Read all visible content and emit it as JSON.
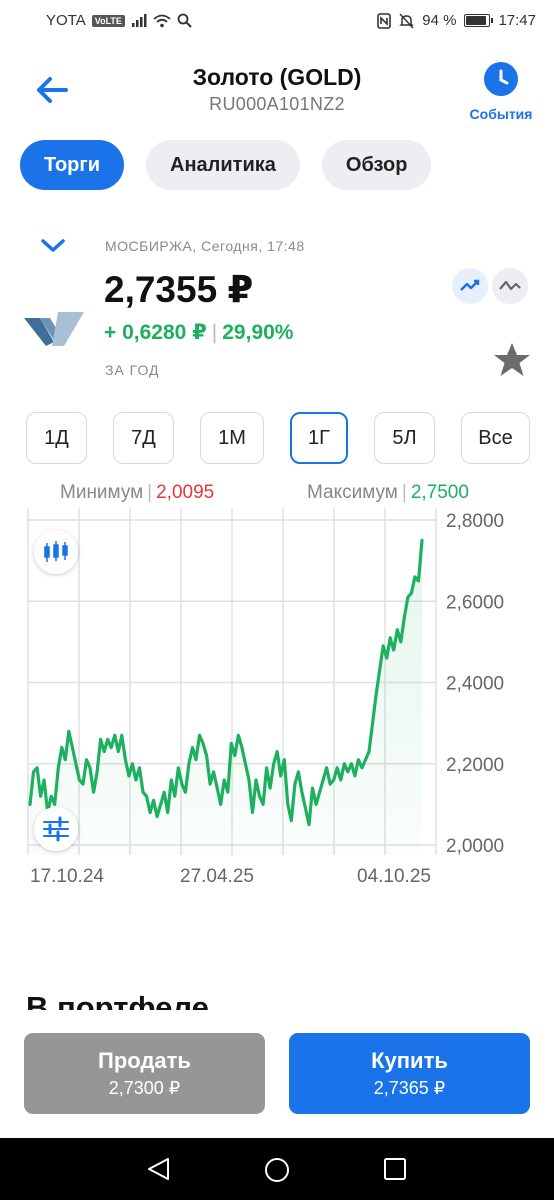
{
  "status_bar": {
    "carrier": "YOTA",
    "volte": "VoLTE",
    "battery_percent": "94 %",
    "battery_level": 0.94,
    "time": "17:47"
  },
  "header": {
    "title": "Золото (GOLD)",
    "isin": "RU000A101NZ2",
    "events_label": "События"
  },
  "tabs": [
    {
      "label": "Торги",
      "active": true
    },
    {
      "label": "Аналитика",
      "active": false
    },
    {
      "label": "Обзор",
      "active": false
    }
  ],
  "quote": {
    "exchange_time": "МОСБИРЖА, Сегодня, 17:48",
    "price": "2,7355 ₽",
    "change_abs": "+ 0,6280 ₽",
    "change_pct": "29,90%",
    "period_label": "ЗА ГОД"
  },
  "periods": [
    {
      "label": "1Д",
      "active": false
    },
    {
      "label": "7Д",
      "active": false
    },
    {
      "label": "1М",
      "active": false
    },
    {
      "label": "1Г",
      "active": true
    },
    {
      "label": "5Л",
      "active": false
    },
    {
      "label": "Все",
      "active": false
    }
  ],
  "range": {
    "min_label": "Минимум",
    "min_value": "2,0095",
    "max_label": "Максимум",
    "max_value": "2,7500"
  },
  "colors": {
    "accent": "#1a73e8",
    "up": "#1db05f",
    "down": "#e53935"
  },
  "chart_data": {
    "type": "line",
    "y_ticks": [
      "2,8000",
      "2,6000",
      "2,4000",
      "2,2000",
      "2,0000"
    ],
    "ylim": [
      2.0,
      2.8
    ],
    "x_ticks": [
      "17.10.24",
      "27.04.25",
      "04.10.25"
    ],
    "grid": true,
    "series": [
      {
        "values": [
          2.1,
          2.18,
          2.19,
          2.12,
          2.16,
          2.08,
          2.12,
          2.1,
          2.19,
          2.24,
          2.21,
          2.28,
          2.24,
          2.2,
          2.16,
          2.15,
          2.21,
          2.19,
          2.13,
          2.18,
          2.26,
          2.23,
          2.26,
          2.24,
          2.27,
          2.23,
          2.27,
          2.21,
          2.17,
          2.2,
          2.16,
          2.19,
          2.13,
          2.12,
          2.08,
          2.11,
          2.07,
          2.1,
          2.13,
          2.08,
          2.16,
          2.12,
          2.19,
          2.15,
          2.13,
          2.2,
          2.24,
          2.21,
          2.27,
          2.25,
          2.22,
          2.15,
          2.18,
          2.14,
          2.1,
          2.16,
          2.13,
          2.25,
          2.22,
          2.27,
          2.24,
          2.2,
          2.16,
          2.08,
          2.16,
          2.12,
          2.1,
          2.19,
          2.14,
          2.2,
          2.23,
          2.17,
          2.21,
          2.1,
          2.06,
          2.15,
          2.18,
          2.13,
          2.09,
          2.05,
          2.14,
          2.1,
          2.13,
          2.16,
          2.19,
          2.15,
          2.16,
          2.19,
          2.16,
          2.2,
          2.18,
          2.2,
          2.17,
          2.21,
          2.19,
          2.21,
          2.23,
          2.3,
          2.37,
          2.43,
          2.49,
          2.46,
          2.51,
          2.48,
          2.53,
          2.5,
          2.56,
          2.61,
          2.62,
          2.66,
          2.65,
          2.75
        ]
      }
    ]
  },
  "bottom": {
    "portfolio_title": "В портфеле",
    "sell_label": "Продать",
    "sell_price": "2,7300 ₽",
    "buy_label": "Купить",
    "buy_price": "2,7365 ₽"
  }
}
